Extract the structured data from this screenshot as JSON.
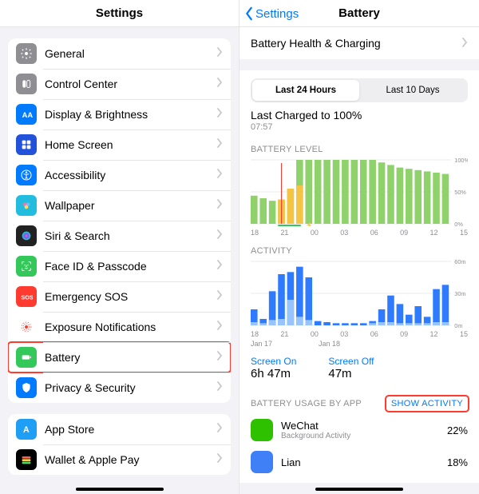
{
  "left": {
    "title": "Settings",
    "groups": [
      [
        {
          "icon": "general",
          "bg": "#8e8e93",
          "label": "General"
        },
        {
          "icon": "control",
          "bg": "#8e8e93",
          "label": "Control Center"
        },
        {
          "icon": "display",
          "bg": "#007aff",
          "label": "Display & Brightness"
        },
        {
          "icon": "home",
          "bg": "#2252d9",
          "label": "Home Screen"
        },
        {
          "icon": "access",
          "bg": "#007aff",
          "label": "Accessibility"
        },
        {
          "icon": "wall",
          "bg": "#22bcde",
          "label": "Wallpaper"
        },
        {
          "icon": "siri",
          "bg": "#222",
          "label": "Siri & Search"
        },
        {
          "icon": "faceid",
          "bg": "#34c759",
          "label": "Face ID & Passcode"
        },
        {
          "icon": "sos",
          "bg": "#ff3b30",
          "label": "Emergency SOS"
        },
        {
          "icon": "expo",
          "bg": "#fff",
          "label": "Exposure Notifications"
        },
        {
          "icon": "battery",
          "bg": "#34c759",
          "label": "Battery",
          "highlight": true
        },
        {
          "icon": "privacy",
          "bg": "#007aff",
          "label": "Privacy & Security"
        }
      ],
      [
        {
          "icon": "appstore",
          "bg": "#1e9ef4",
          "label": "App Store"
        },
        {
          "icon": "wallet",
          "bg": "#000",
          "label": "Wallet & Apple Pay"
        }
      ]
    ]
  },
  "right": {
    "back": "Settings",
    "title": "Battery",
    "health_row": "Battery Health & Charging",
    "segments": [
      "Last 24 Hours",
      "Last 10 Days"
    ],
    "active_segment": 0,
    "charged_title": "Last Charged to 100%",
    "charged_sub": "07:57",
    "battery_level_head": "BATTERY LEVEL",
    "activity_head": "ACTIVITY",
    "screen_on_l": "Screen On",
    "screen_on_v": "6h 47m",
    "screen_off_l": "Screen Off",
    "screen_off_v": "47m",
    "usage_head": "BATTERY USAGE BY APP",
    "show_activity": "SHOW ACTIVITY",
    "xaxis": [
      "18",
      "21",
      "00",
      "03",
      "06",
      "09",
      "12",
      "15"
    ],
    "date_labels": [
      "Jan 17",
      "Jan 18"
    ],
    "level_ylabels": [
      "100%",
      "50%",
      "0%"
    ],
    "activity_ylabels": [
      "60m",
      "30m",
      "0m"
    ],
    "apps": [
      {
        "name": "WeChat",
        "sub": "Background Activity",
        "pct": "22%",
        "bg": "#2dc100"
      },
      {
        "name": "Lian",
        "sub": "",
        "pct": "18%",
        "bg": "#3f80f6"
      }
    ]
  },
  "chart_data": [
    {
      "type": "bar",
      "title": "BATTERY LEVEL",
      "ylabel": "%",
      "ylim": [
        0,
        100
      ],
      "categories": [
        "18",
        "19",
        "20",
        "21",
        "22",
        "23",
        "00",
        "01",
        "02",
        "03",
        "04",
        "05",
        "06",
        "07",
        "08",
        "09",
        "10",
        "11",
        "12",
        "13",
        "14",
        "15"
      ],
      "series": [
        {
          "name": "total",
          "values": [
            44,
            40,
            36,
            38,
            55,
            100,
            100,
            100,
            100,
            100,
            100,
            100,
            100,
            100,
            96,
            92,
            88,
            86,
            84,
            82,
            80,
            78
          ]
        },
        {
          "name": "low_power_or_charging",
          "values": [
            0,
            0,
            0,
            38,
            55,
            60,
            0,
            0,
            0,
            0,
            0,
            0,
            0,
            0,
            0,
            0,
            0,
            0,
            0,
            0,
            0,
            0
          ]
        }
      ],
      "colors": {
        "total": "#8fd16a",
        "low_power_or_charging": "#f4c542"
      }
    },
    {
      "type": "bar",
      "title": "ACTIVITY",
      "ylabel": "minutes",
      "ylim": [
        0,
        60
      ],
      "categories": [
        "18",
        "19",
        "20",
        "21",
        "22",
        "23",
        "00",
        "01",
        "02",
        "03",
        "04",
        "05",
        "06",
        "07",
        "08",
        "09",
        "10",
        "11",
        "12",
        "13",
        "14",
        "15"
      ],
      "series": [
        {
          "name": "screen_on",
          "values": [
            15,
            6,
            32,
            48,
            50,
            55,
            45,
            4,
            3,
            2,
            2,
            2,
            2,
            4,
            15,
            28,
            20,
            10,
            18,
            8,
            34,
            38
          ]
        },
        {
          "name": "screen_off",
          "values": [
            3,
            2,
            5,
            6,
            24,
            8,
            5,
            0,
            0,
            0,
            0,
            0,
            0,
            2,
            3,
            3,
            2,
            2,
            2,
            2,
            3,
            3
          ]
        }
      ],
      "colors": {
        "screen_on": "#2f7bff",
        "screen_off": "#97c4ff"
      }
    }
  ]
}
